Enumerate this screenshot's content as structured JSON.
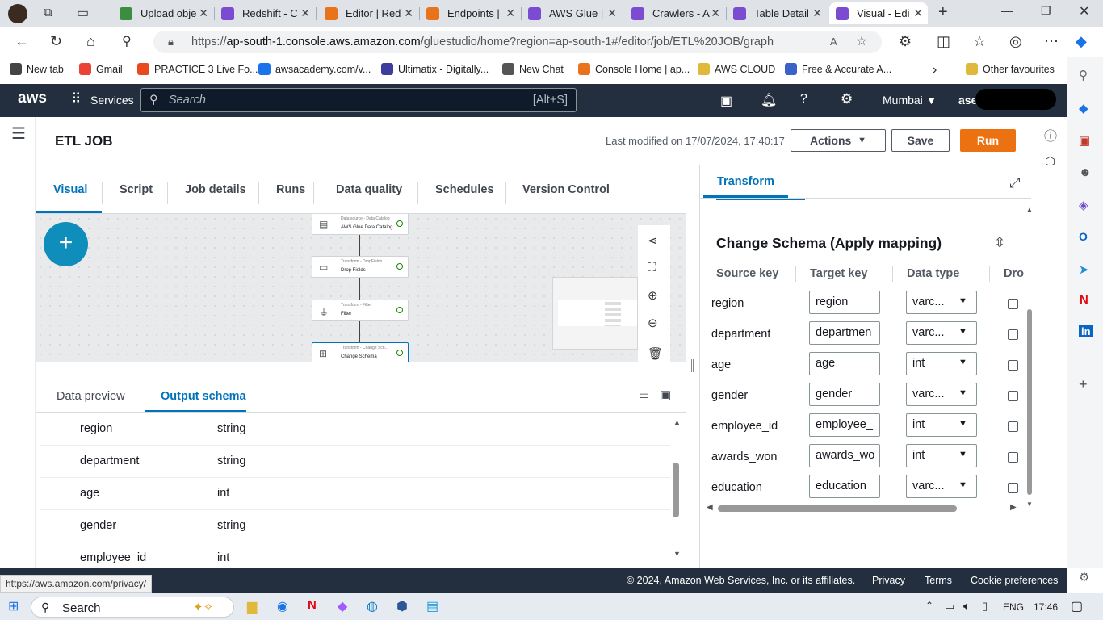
{
  "browser": {
    "tabs": [
      {
        "label": "Upload obje",
        "color": "#3b8d3f"
      },
      {
        "label": "Redshift - C",
        "color": "#7b4bd1"
      },
      {
        "label": "Editor | Red",
        "color": "#e8731a"
      },
      {
        "label": "Endpoints |",
        "color": "#e8731a"
      },
      {
        "label": "AWS Glue |",
        "color": "#7b4bd1"
      },
      {
        "label": "Crawlers - A",
        "color": "#7b4bd1"
      },
      {
        "label": "Table Detail",
        "color": "#7b4bd1"
      },
      {
        "label": "Visual - Edi",
        "color": "#7b4bd1"
      }
    ],
    "url_prefix": "https://",
    "url_host": "ap-south-1.console.aws.amazon.com",
    "url_path": "/gluestudio/home?region=ap-south-1#/editor/job/ETL%20JOB/graph",
    "favorites": [
      {
        "label": "New tab",
        "color": "#444"
      },
      {
        "label": "Gmail",
        "color": "#ea4335"
      },
      {
        "label": "PRACTICE 3 Live Fo...",
        "color": "#e8491d"
      },
      {
        "label": "awsacademy.com/v...",
        "color": "#1a73e8"
      },
      {
        "label": "Ultimatix - Digitally...",
        "color": "#3d3d9e"
      },
      {
        "label": "New Chat",
        "color": "#555"
      },
      {
        "label": "Console Home | ap...",
        "color": "#e8731a"
      },
      {
        "label": "AWS CLOUD",
        "color": "#e0b83c"
      },
      {
        "label": "Free & Accurate A...",
        "color": "#3a62c9"
      }
    ],
    "other_favourites": "Other favourites"
  },
  "aws": {
    "logo": "aws",
    "services": "Services",
    "search_placeholder": "Search",
    "search_shortcut": "[Alt+S]",
    "region": "Mumbai",
    "user": "asee"
  },
  "job": {
    "title": "ETL JOB",
    "last_modified": "Last modified on 17/07/2024, 17:40:17",
    "actions_label": "Actions",
    "save_label": "Save",
    "run_label": "Run"
  },
  "editor_tabs": [
    "Visual",
    "Script",
    "Job details",
    "Runs",
    "Data quality",
    "Schedules",
    "Version Control"
  ],
  "nodes": [
    {
      "type": "Data source - Data Catalog",
      "name": "AWS Glue Data Catalog",
      "icon": "▤"
    },
    {
      "type": "Transform - DropFields",
      "name": "Drop Fields",
      "icon": "▭"
    },
    {
      "type": "Transform - Filter",
      "name": "Filter",
      "icon": "⏚"
    },
    {
      "type": "Transform - Change Sch...",
      "name": "Change Schema",
      "icon": "⊞"
    }
  ],
  "bottom": {
    "tabs": [
      "Data preview",
      "Output schema"
    ],
    "rows": [
      {
        "key": "region",
        "type": "string"
      },
      {
        "key": "department",
        "type": "string"
      },
      {
        "key": "age",
        "type": "int"
      },
      {
        "key": "gender",
        "type": "string"
      },
      {
        "key": "employee_id",
        "type": "int"
      }
    ]
  },
  "transform": {
    "tab_label": "Transform",
    "heading": "Change Schema (Apply mapping)",
    "columns": [
      "Source key",
      "Target key",
      "Data type",
      "Dro"
    ],
    "mappings": [
      {
        "source": "region",
        "target": "region",
        "type": "varc..."
      },
      {
        "source": "department",
        "target": "departmen",
        "type": "varc..."
      },
      {
        "source": "age",
        "target": "age",
        "type": "int"
      },
      {
        "source": "gender",
        "target": "gender",
        "type": "varc..."
      },
      {
        "source": "employee_id",
        "target": "employee_",
        "type": "int"
      },
      {
        "source": "awards_won",
        "target": "awards_wo",
        "type": "int"
      },
      {
        "source": "education",
        "target": "education",
        "type": "varc..."
      }
    ]
  },
  "footer": {
    "copyright": "© 2024, Amazon Web Services, Inc. or its affiliates.",
    "privacy": "Privacy",
    "terms": "Terms",
    "cookies": "Cookie preferences",
    "status_url": "https://aws.amazon.com/privacy/"
  },
  "taskbar": {
    "search": "Search",
    "lang": "ENG",
    "time": "17:46"
  }
}
